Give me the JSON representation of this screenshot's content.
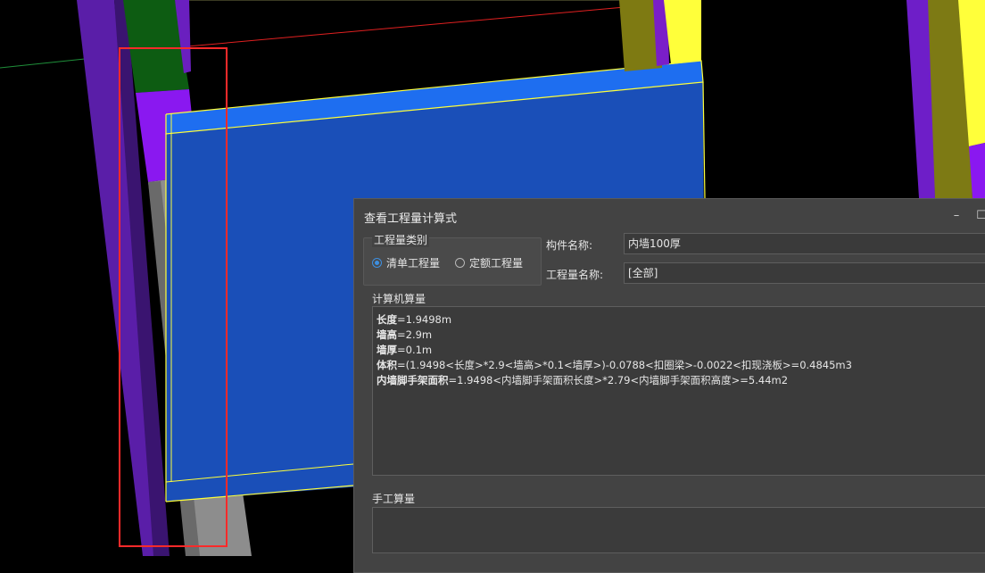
{
  "dialog": {
    "title": "查看工程量计算式",
    "minimize_icon": "minimize-icon",
    "maximize_icon": "maximize-icon",
    "quantity_type": {
      "label": "工程量类别",
      "options": [
        {
          "label": "清单工程量",
          "selected": true
        },
        {
          "label": "定额工程量",
          "selected": false
        }
      ]
    },
    "component_name": {
      "label": "构件名称:",
      "value": "内墙100厚"
    },
    "quantity_name": {
      "label": "工程量名称:",
      "value": "[全部]"
    },
    "computer_calc": {
      "label": "计算机算量",
      "lines": [
        {
          "name": "长度",
          "expr": "=1.9498m"
        },
        {
          "name": "墙高",
          "expr": "=2.9m"
        },
        {
          "name": "墙厚",
          "expr": "=0.1m"
        },
        {
          "name": "体积",
          "expr": "=(1.9498<长度>*2.9<墙高>*0.1<墙厚>)-0.0788<扣圈梁>-0.0022<扣现浇板>=0.4845m3"
        },
        {
          "name": "内墙脚手架面积",
          "expr": "=1.9498<内墙脚手架面积长度>*2.79<内墙脚手架面积高度>=5.44m2"
        }
      ]
    },
    "manual_calc": {
      "label": "手工算量",
      "value": ""
    }
  },
  "colors": {
    "dialog_bg": "#434343",
    "wall_blue": "#1a55c8",
    "highlight_yellow": "#ffff3a",
    "selection_red": "#ff2a2a",
    "radio_accent": "#3d8fe0"
  }
}
